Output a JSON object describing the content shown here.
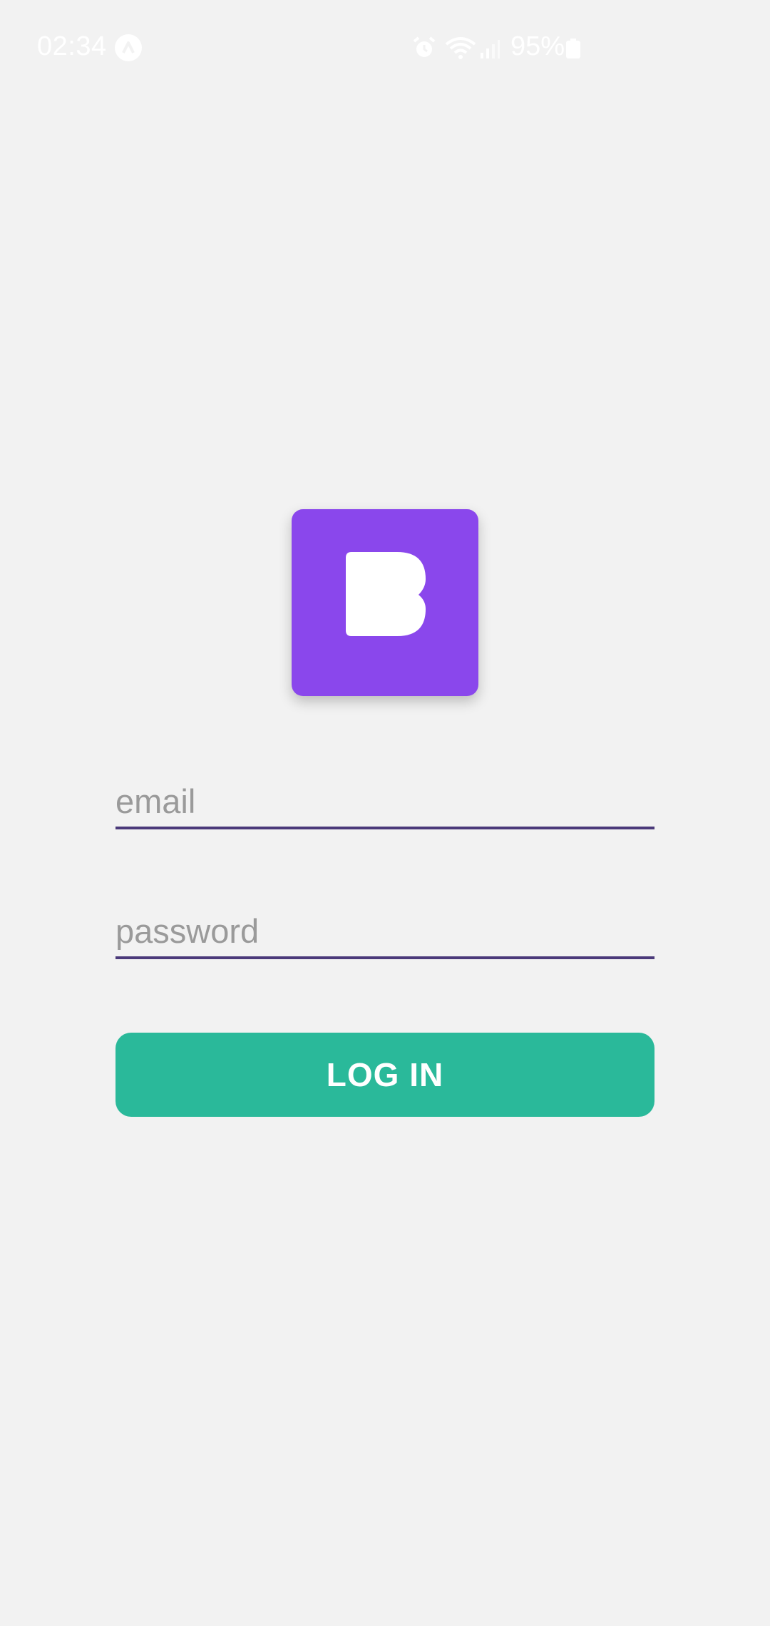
{
  "status_bar": {
    "time": "02:34",
    "battery_percent": "95%",
    "icons": [
      "app-notification-icon",
      "alarm-icon",
      "wifi-icon",
      "signal-icon",
      "battery-icon"
    ]
  },
  "logo": {
    "icon": "b-logo-icon",
    "background_color": "#8a47ec"
  },
  "login_form": {
    "email_placeholder": "email",
    "email_value": "",
    "password_placeholder": "password",
    "password_value": "",
    "login_label": "LOG IN",
    "button_color": "#2ab99a",
    "underline_color": "#4b3a7a"
  }
}
